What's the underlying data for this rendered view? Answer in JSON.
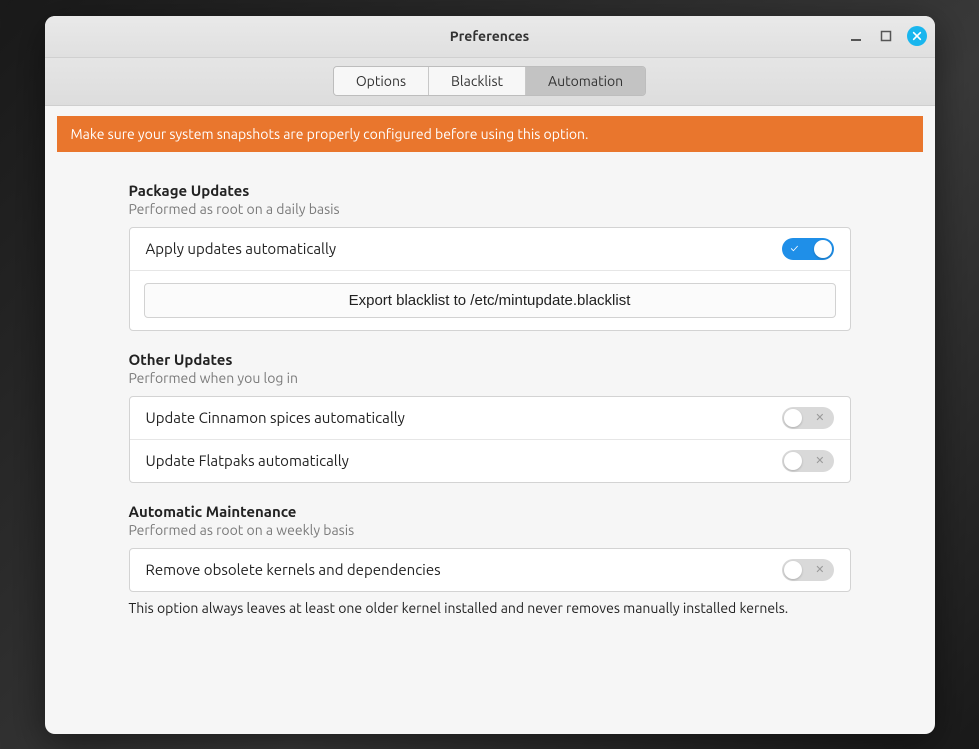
{
  "window": {
    "title": "Preferences"
  },
  "tabs": {
    "options": "Options",
    "blacklist": "Blacklist",
    "automation": "Automation",
    "selected": "automation"
  },
  "alert": "Make sure your system snapshots are properly configured before using this option.",
  "sections": {
    "package": {
      "title": "Package Updates",
      "subtitle": "Performed as root on a daily basis",
      "apply_label": "Apply updates automatically",
      "apply_on": true,
      "export_label": "Export blacklist to /etc/mintupdate.blacklist"
    },
    "other": {
      "title": "Other Updates",
      "subtitle": "Performed when you log in",
      "cinnamon_label": "Update Cinnamon spices automatically",
      "cinnamon_on": false,
      "flatpak_label": "Update Flatpaks automatically",
      "flatpak_on": false
    },
    "maint": {
      "title": "Automatic Maintenance",
      "subtitle": "Performed as root on a weekly basis",
      "kernel_label": "Remove obsolete kernels and dependencies",
      "kernel_on": false,
      "note": "This option always leaves at least one older kernel installed and never removes manually installed kernels."
    }
  },
  "colors": {
    "accent_on": "#1f8fe8",
    "alert_bg": "#e9762d",
    "close_bg": "#19b6ee"
  }
}
